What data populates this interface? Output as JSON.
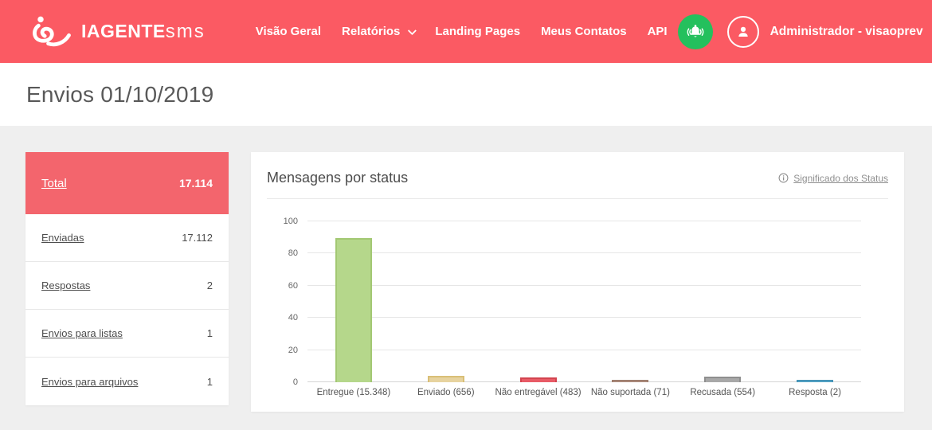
{
  "brand": {
    "name_bold": "IAGENTE",
    "name_light": "sms"
  },
  "colors": {
    "nav_background": "#fb5a63",
    "active_row_background": "#f3656d",
    "notification_green": "#24c05d",
    "page_background": "#efefef"
  },
  "nav": {
    "items": [
      {
        "label": "Visão Geral"
      },
      {
        "label": "Relatórios",
        "has_dropdown": true
      },
      {
        "label": "Landing Pages"
      },
      {
        "label": "Meus Contatos"
      },
      {
        "label": "API"
      }
    ]
  },
  "user": {
    "label": "Administrador - visaoprev"
  },
  "page": {
    "title": "Envios 01/10/2019"
  },
  "sidebar": {
    "total": {
      "label": "Total",
      "value": "17.114"
    },
    "rows": [
      {
        "label": "Enviadas",
        "value": "17.112"
      },
      {
        "label": "Respostas",
        "value": "2"
      },
      {
        "label": "Envios para listas",
        "value": "1"
      },
      {
        "label": "Envios para arquivos",
        "value": "1"
      }
    ]
  },
  "panel": {
    "title": "Mensagens por status",
    "info_link": "Significado dos Status"
  },
  "chart_data": {
    "type": "bar",
    "title": "Mensagens por status",
    "categories": [
      "Entregue (15.348)",
      "Enviado (656)",
      "Não entregável (483)",
      "Não suportada (71)",
      "Recusada (554)",
      "Resposta (2)"
    ],
    "values": [
      15348,
      656,
      483,
      71,
      554,
      2
    ],
    "total": 17114,
    "unit": "percent_of_total_messages",
    "xlabel": "",
    "ylabel": "",
    "ylim": [
      0,
      100
    ],
    "yticks": [
      0,
      20,
      40,
      60,
      80,
      100
    ],
    "grid": true,
    "legend": false,
    "bar_colors": [
      {
        "fill": "#b5d78b",
        "border": "#a3c873"
      },
      {
        "fill": "#e7d39f",
        "border": "#d9bf77"
      },
      {
        "fill": "#e85b66",
        "border": "#d3444f"
      },
      {
        "fill": "#b08f80",
        "border": "#a07f70"
      },
      {
        "fill": "#a8a8a8",
        "border": "#8f8f8f"
      },
      {
        "fill": "#57a7c9",
        "border": "#4795b8"
      }
    ]
  }
}
